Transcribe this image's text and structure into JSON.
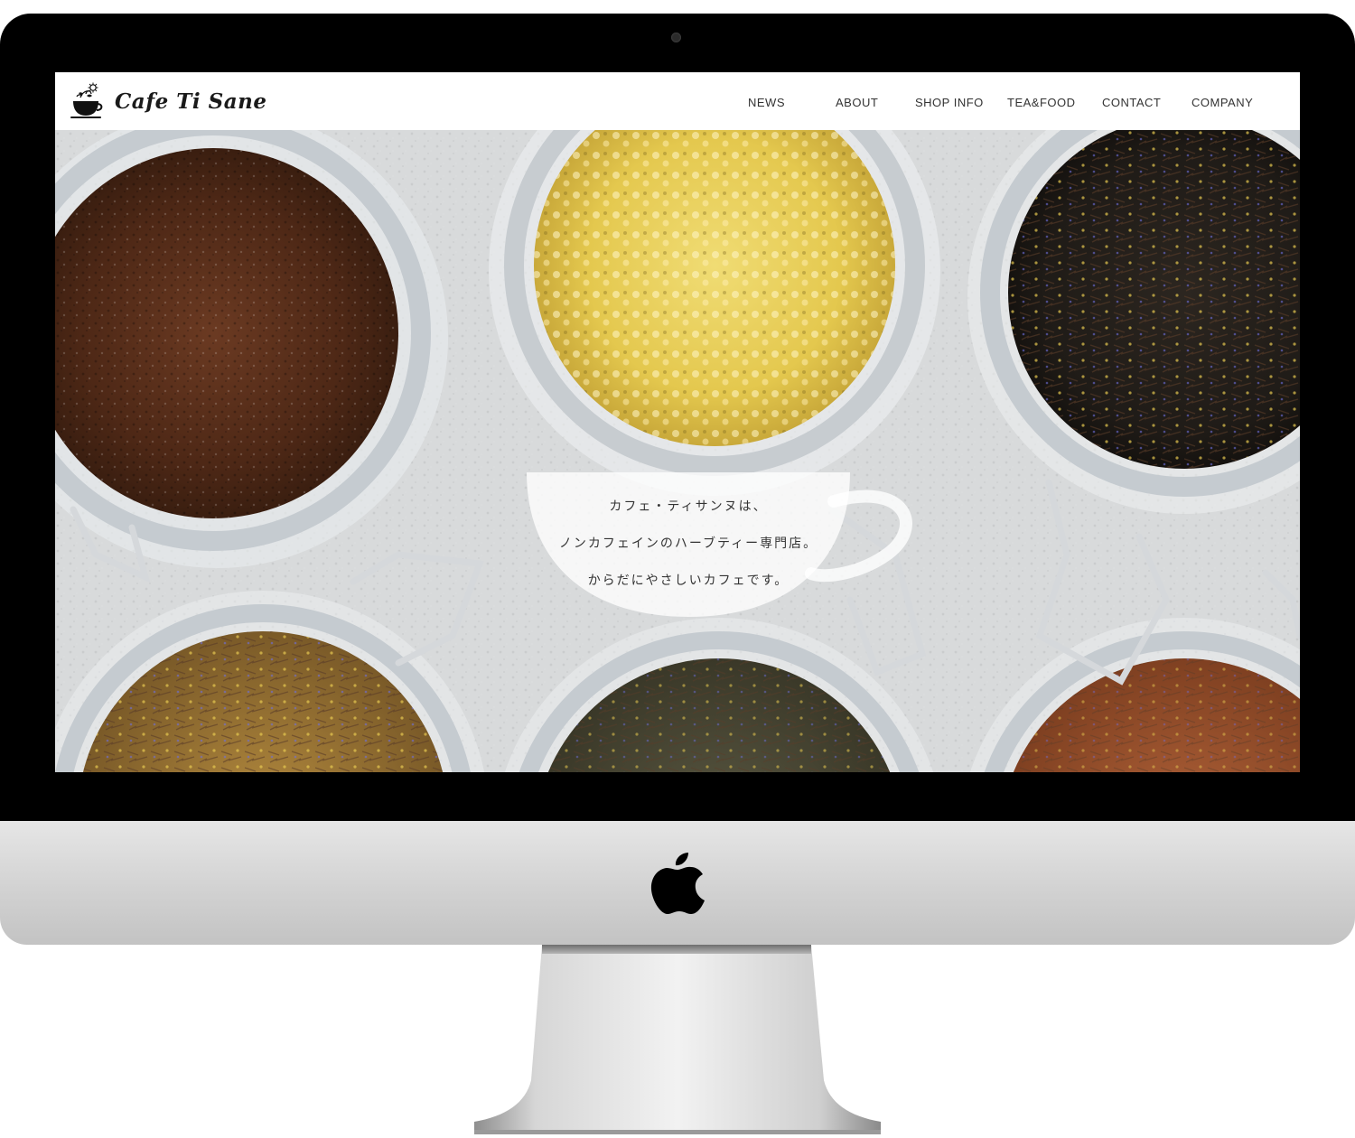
{
  "site": {
    "logo_text": "Cafe Ti Sane",
    "nav": [
      {
        "label": "NEWS"
      },
      {
        "label": "ABOUT"
      },
      {
        "label": "SHOP INFO"
      },
      {
        "label": "TEA&FOOD"
      },
      {
        "label": "CONTACT"
      },
      {
        "label": "COMPANY"
      }
    ]
  },
  "hero": {
    "lines": [
      "カフェ・ティサンヌは、",
      "ノンカフェインのハーブティー専門店。",
      "からだにやさしいカフェです。"
    ]
  },
  "icons": {
    "logo": "teacup-with-herbs-icon",
    "device_logo": "apple-logo-icon"
  },
  "colors": {
    "bezel": "#000000",
    "header_bg": "#ffffff",
    "text": "#333333"
  }
}
